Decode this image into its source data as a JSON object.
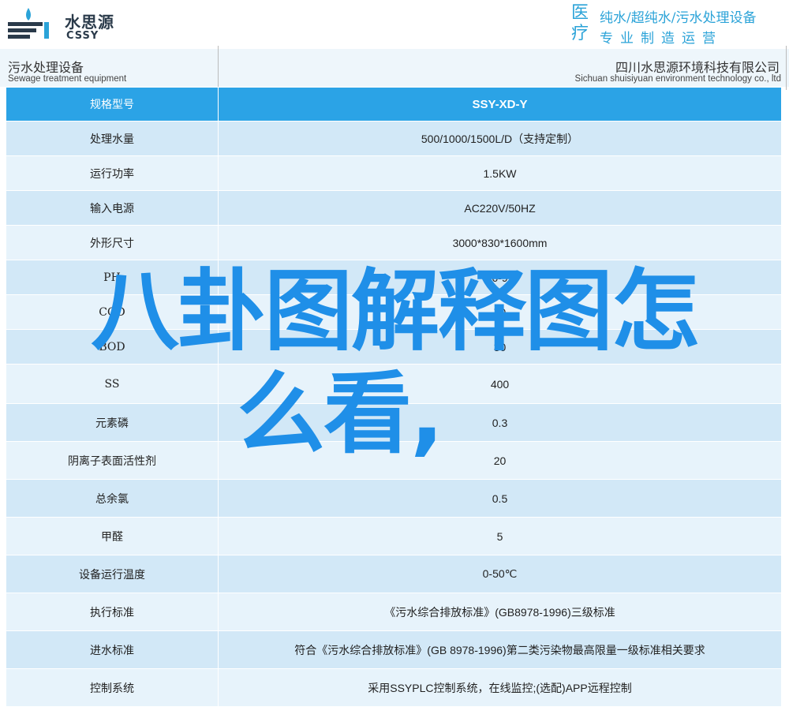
{
  "brand": {
    "name_cn": "水思源",
    "name_en": "CSSY",
    "slogan_char_1": "医",
    "slogan_char_2": "疗",
    "slogan_line_1": "纯水/超纯水/污水处理设备",
    "slogan_line_2": "专业制造运营",
    "accent_color": "#2ba3d8"
  },
  "subheader": {
    "left_cn": "污水处理设备",
    "left_en": "Sewage treatment equipment",
    "right_cn": "四川水思源环境科技有限公司",
    "right_en": "Sichuan shuisiyuan environment technology co., ltd"
  },
  "table": {
    "header": {
      "key": "规格型号",
      "value": "SSY-XD-Y"
    },
    "rows": [
      {
        "key": "处理水量",
        "value": "500/1000/1500L/D（支持定制）"
      },
      {
        "key": "运行功率",
        "value": "1.5KW"
      },
      {
        "key": "输入电源",
        "value": "AC220V/50HZ"
      },
      {
        "key": "外形尺寸",
        "value": "3000*830*1600mm"
      },
      {
        "key": "PH",
        "value": "6-9"
      },
      {
        "key": "COD",
        "value": "70"
      },
      {
        "key": "BOD",
        "value": "30"
      },
      {
        "key": "SS",
        "value": "400"
      },
      {
        "key": "元素磷",
        "value": "0.3"
      },
      {
        "key": "阴离子表面活性剂",
        "value": "20"
      },
      {
        "key": "总余氯",
        "value": "0.5"
      },
      {
        "key": "甲醛",
        "value": "5"
      },
      {
        "key": "设备运行温度",
        "value": "0-50℃"
      },
      {
        "key": "执行标准",
        "value": "《污水综合排放标准》(GB8978-1996)三级标准"
      },
      {
        "key": "进水标准",
        "value": "符合《污水综合排放标准》(GB 8978-1996)第二类污染物最高限量一级标准相关要求"
      },
      {
        "key": "控制系统",
        "value": "采用SSYPLC控制系统，在线监控;(选配)APP远程控制"
      }
    ]
  },
  "overlay": {
    "line_1": "八卦图解释图怎",
    "line_2": "么看,",
    "color": "#1f8fe8"
  }
}
